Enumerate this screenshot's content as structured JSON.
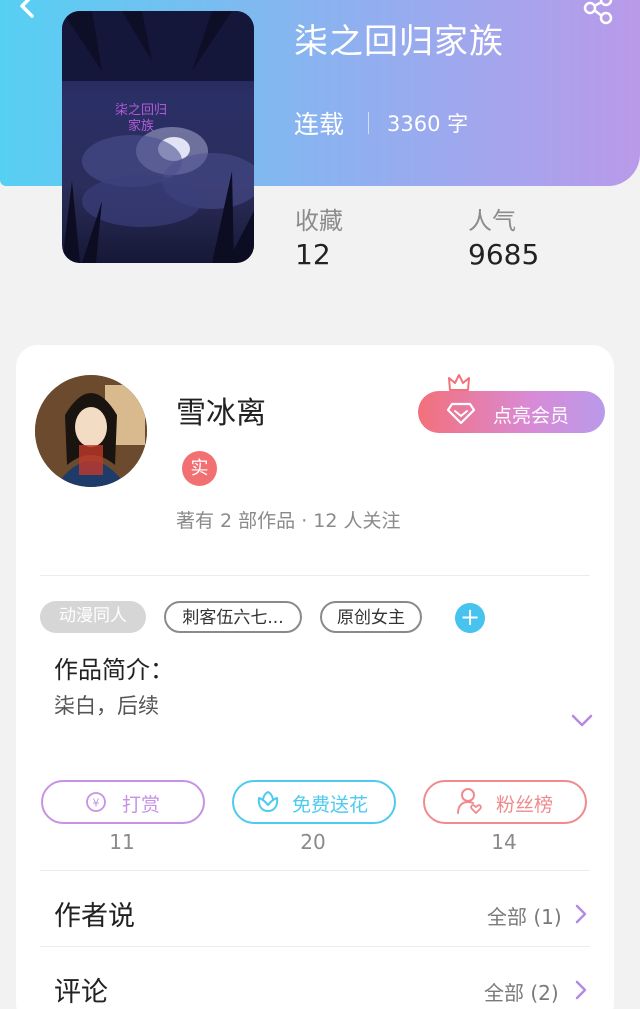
{
  "book": {
    "title": "柒之回归家族",
    "cover_text_line1": "柒之回归",
    "cover_text_line2": "家族",
    "status": "连载",
    "word_count": "3360 字"
  },
  "stats": {
    "favorites_label": "收藏",
    "favorites_value": "12",
    "popularity_label": "人气",
    "popularity_value": "9685"
  },
  "author": {
    "name": "雪冰离",
    "badge": "实",
    "meta": "著有 2 部作品 · 12 人关注"
  },
  "vip": {
    "label": "点亮会员"
  },
  "tags": [
    "动漫同人",
    "刺客伍六七...",
    "原创女主"
  ],
  "tag_add_symbol": "+",
  "intro": {
    "label": "作品简介：",
    "text": "柒白，后续"
  },
  "actions": [
    {
      "label": "打赏",
      "count": "11",
      "color": "#c792e6"
    },
    {
      "label": "免费送花",
      "count": "20",
      "color": "#4ccaf0"
    },
    {
      "label": "粉丝榜",
      "count": "14",
      "color": "#f08a8c"
    }
  ],
  "sections": {
    "author_says": {
      "title": "作者说",
      "more": "全部 (1)"
    },
    "comments": {
      "title": "评论",
      "more": "全部 (2)"
    }
  },
  "colors": {
    "header_gradient_start": "#56d0f2",
    "header_gradient_end": "#b99ae9",
    "accent_purple": "#b58ae0",
    "badge_red": "#f26f72"
  },
  "icons": [
    "back-arrow-icon",
    "share-icon",
    "crown-icon",
    "diamond-icon",
    "yen-coin-icon",
    "flower-icon",
    "user-heart-icon",
    "chevron-down-icon",
    "chevron-right-icon"
  ]
}
